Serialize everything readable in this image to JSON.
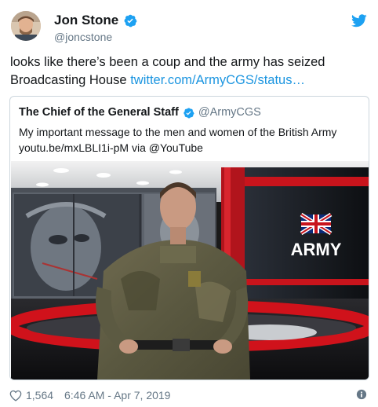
{
  "author": {
    "name": "Jon Stone",
    "handle": "@joncstone"
  },
  "tweet": {
    "text": "looks like there’s been a coup and the army has seized Broadcasting House",
    "link": "twitter.com/ArmyCGS/status…"
  },
  "quote": {
    "name": "The Chief of the General Staff",
    "handle": "@ArmyCGS",
    "text_line1": "My important message to the men and women of the British Army",
    "text_line2": "youtu.be/mxLBLI1i-pM via @YouTube",
    "video_logo_text": "ARMY"
  },
  "footer": {
    "likes": "1,564",
    "timestamp": "6:46 AM - Apr 7, 2019"
  },
  "colors": {
    "link": "#1b95e0",
    "verified": "#1da1f2",
    "twitter_bird": "#1da1f2",
    "text_secondary": "#657786",
    "studio_red": "#d0121b"
  },
  "icons": [
    "verified-badge-icon",
    "twitter-bird-icon",
    "heart-icon",
    "info-icon"
  ]
}
